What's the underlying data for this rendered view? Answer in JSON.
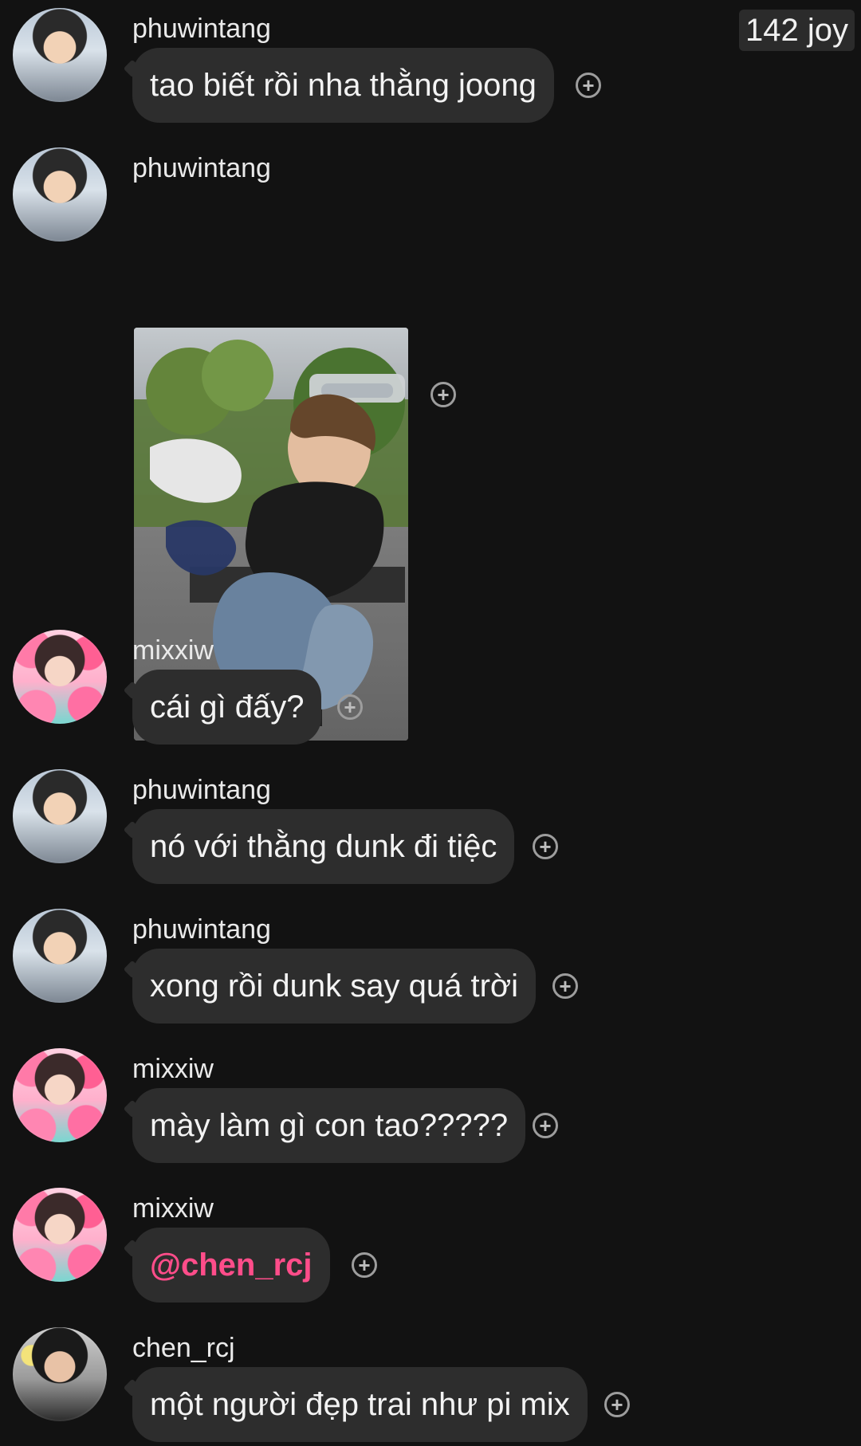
{
  "top_badge": "142 joy",
  "messages": [
    {
      "username": "phuwintang",
      "text": "tao biết rồi nha thằng joong"
    },
    {
      "username": "phuwintang",
      "image_alt": ""
    },
    {
      "username": "mixxiw",
      "text": "cái gì đấy?"
    },
    {
      "username": "phuwintang",
      "text": "nó với thằng dunk đi tiệc"
    },
    {
      "username": "phuwintang",
      "text": "xong rồi dunk say quá trời"
    },
    {
      "username": "mixxiw",
      "text": "mày làm gì con tao?????"
    },
    {
      "username": "mixxiw",
      "text": "@chen_rcj"
    },
    {
      "username": "chen_rcj",
      "text": "một người đẹp trai như pi mix"
    }
  ],
  "icons": {
    "add_reaction": "plus-circle-icon"
  },
  "colors": {
    "background": "#121212",
    "bubble": "#2d2d2d",
    "mention": "#ff4d8a"
  }
}
